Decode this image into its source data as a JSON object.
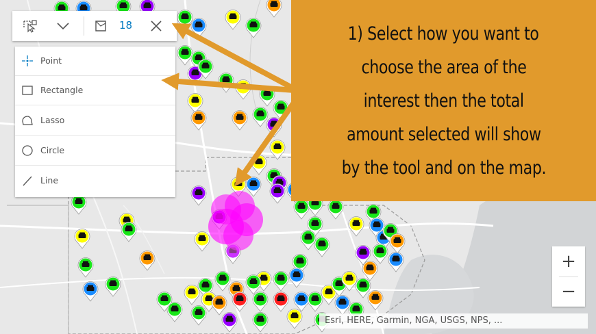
{
  "toolbar": {
    "selection_count": "18",
    "tools": [
      "select-by-shape",
      "dropdown",
      "clear-selection"
    ]
  },
  "menu": {
    "items": [
      {
        "label": "Point",
        "icon": "point-crosshair-icon"
      },
      {
        "label": "Rectangle",
        "icon": "rectangle-icon"
      },
      {
        "label": "Lasso",
        "icon": "lasso-icon"
      },
      {
        "label": "Circle",
        "icon": "circle-icon"
      },
      {
        "label": "Line",
        "icon": "line-icon"
      }
    ]
  },
  "zoom": {
    "in_label": "+",
    "out_label": "−"
  },
  "attribution": "Esri, HERE, Garmin, NGA, USGS, NPS, ...",
  "callout": {
    "lines": [
      "1) Select how you want to",
      "choose the area of the",
      "interest then the total",
      "amount selected will show",
      "by the tool and on the map."
    ]
  },
  "colors": {
    "callout_bg": "#e19a2c",
    "arrow": "#e19a2c",
    "selected_count": "#0079c1",
    "highlight": "#ff00ff",
    "marker_green": "#19e619",
    "marker_yellow": "#ffff00",
    "marker_orange": "#ff9900",
    "marker_purple": "#9900ff",
    "marker_blue": "#1a8cff",
    "marker_red": "#ff2020"
  }
}
